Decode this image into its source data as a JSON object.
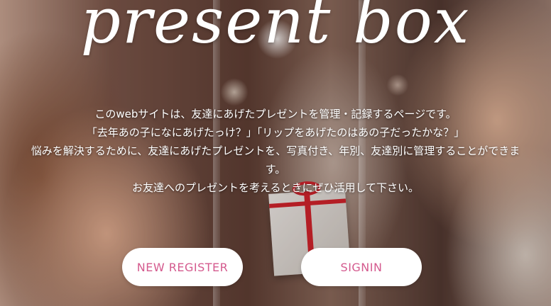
{
  "hero": {
    "logo": "present box",
    "intro_lines": [
      "このwebサイトは、友達にあげたプレゼントを管理・記録するページです。",
      "「去年あの子になにあげたっけ？」「リップをあげたのはあの子だったかな？」",
      "悩みを解決するために、友達にあげたプレゼントを、写真付き、年別、友達別に管理することができま",
      "す。",
      "お友達へのプレゼントを考えるときにぜひ活用して下さい。"
    ]
  },
  "actions": {
    "register_label": "NEW REGISTER",
    "signin_label": "SIGNIN"
  },
  "colors": {
    "button_text": "#d45a8e",
    "button_bg": "#ffffff",
    "gift_ribbon": "#d3202a"
  }
}
